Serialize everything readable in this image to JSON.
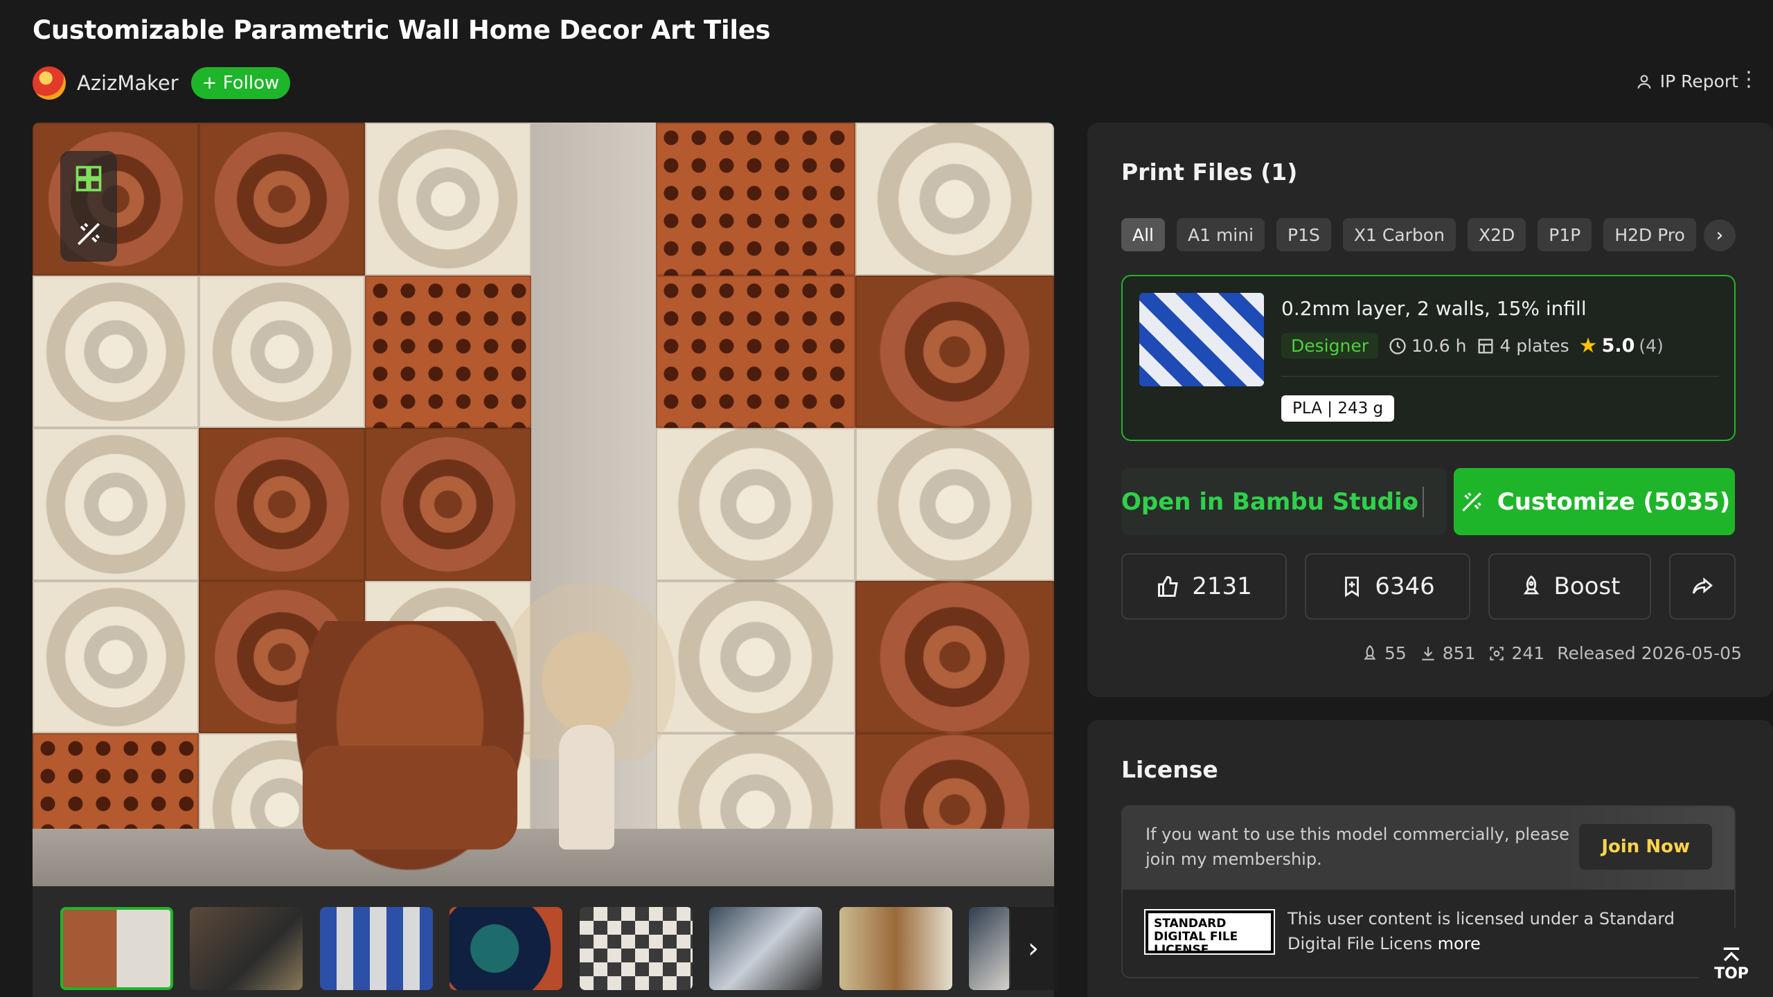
{
  "page": {
    "title": "Customizable Parametric Wall Home Decor Art Tiles"
  },
  "author": {
    "name": "AzizMaker",
    "follow_label": "+ Follow"
  },
  "header_actions": {
    "ip_report_label": "IP Report"
  },
  "gallery": {
    "thumbnail_count": 8,
    "active_index": 0
  },
  "print_files": {
    "title": "Print Files (1)",
    "printer_filters": [
      "All",
      "A1 mini",
      "P1S",
      "X1 Carbon",
      "X2D",
      "P1P",
      "H2D Pro"
    ],
    "active_filter": "All",
    "profile": {
      "name": "0.2mm layer, 2 walls, 15% infill",
      "badge": "Designer",
      "print_time": "10.6 h",
      "plates": "4 plates",
      "rating": "5.0",
      "rating_count": "(4)",
      "material": "PLA | 243 g"
    },
    "open_button_label": "Open in Bambu Studio",
    "customize_button_label": "Customize  (5035)"
  },
  "actions": {
    "likes": "2131",
    "collects": "6346",
    "boost_label": "Boost"
  },
  "stats": {
    "boosts": "55",
    "downloads": "851",
    "prints": "241",
    "released": "Released 2026-05-05"
  },
  "license": {
    "title": "License",
    "membership_text": "If you want to use this model commercially, please join my membership.",
    "join_label": "Join Now",
    "badge_text": "STANDARD DIGITAL FILE LICENSE",
    "description": "This user content is licensed under a Standard Digital File Licens",
    "more_label": "more"
  },
  "top_button_label": "TOP",
  "colors": {
    "accent": "#1fb52a",
    "accent_text": "#2fd14a",
    "join_text": "#ffd44a",
    "star": "#ffc400"
  }
}
